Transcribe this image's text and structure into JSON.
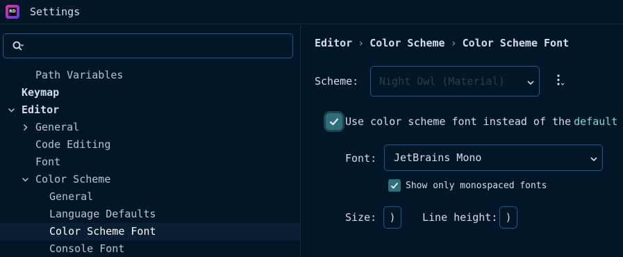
{
  "window": {
    "title": "Settings",
    "logo_text": "RD"
  },
  "search": {
    "value": "",
    "placeholder": ""
  },
  "tree": [
    {
      "label": "Path Variables"
    },
    {
      "label": "Keymap"
    },
    {
      "label": "Editor"
    },
    {
      "label": "General"
    },
    {
      "label": "Code Editing"
    },
    {
      "label": "Font"
    },
    {
      "label": "Color Scheme"
    },
    {
      "label": "General"
    },
    {
      "label": "Language Defaults"
    },
    {
      "label": "Color Scheme Font"
    },
    {
      "label": "Console Font"
    }
  ],
  "breadcrumb": [
    "Editor",
    "Color Scheme",
    "Color Scheme Font"
  ],
  "breadcrumb_separator": "›",
  "scheme": {
    "label": "Scheme:",
    "value": "Night Owl (Material)"
  },
  "use_scheme_font": {
    "label": "Use color scheme font instead of the",
    "link": "default",
    "checked": true
  },
  "font": {
    "label": "Font:",
    "value": "JetBrains Mono"
  },
  "monospaced_only": {
    "label": "Show only monospaced fonts",
    "checked": true
  },
  "size": {
    "label": "Size:",
    "value": ")"
  },
  "line_height": {
    "label": "Line height:",
    "value": ")"
  },
  "colors": {
    "background": "#011627",
    "selection": "#0a1f33",
    "accent": "#1f5a8c",
    "link": "#7fdbca",
    "checkbox": "#2f6f7a"
  }
}
